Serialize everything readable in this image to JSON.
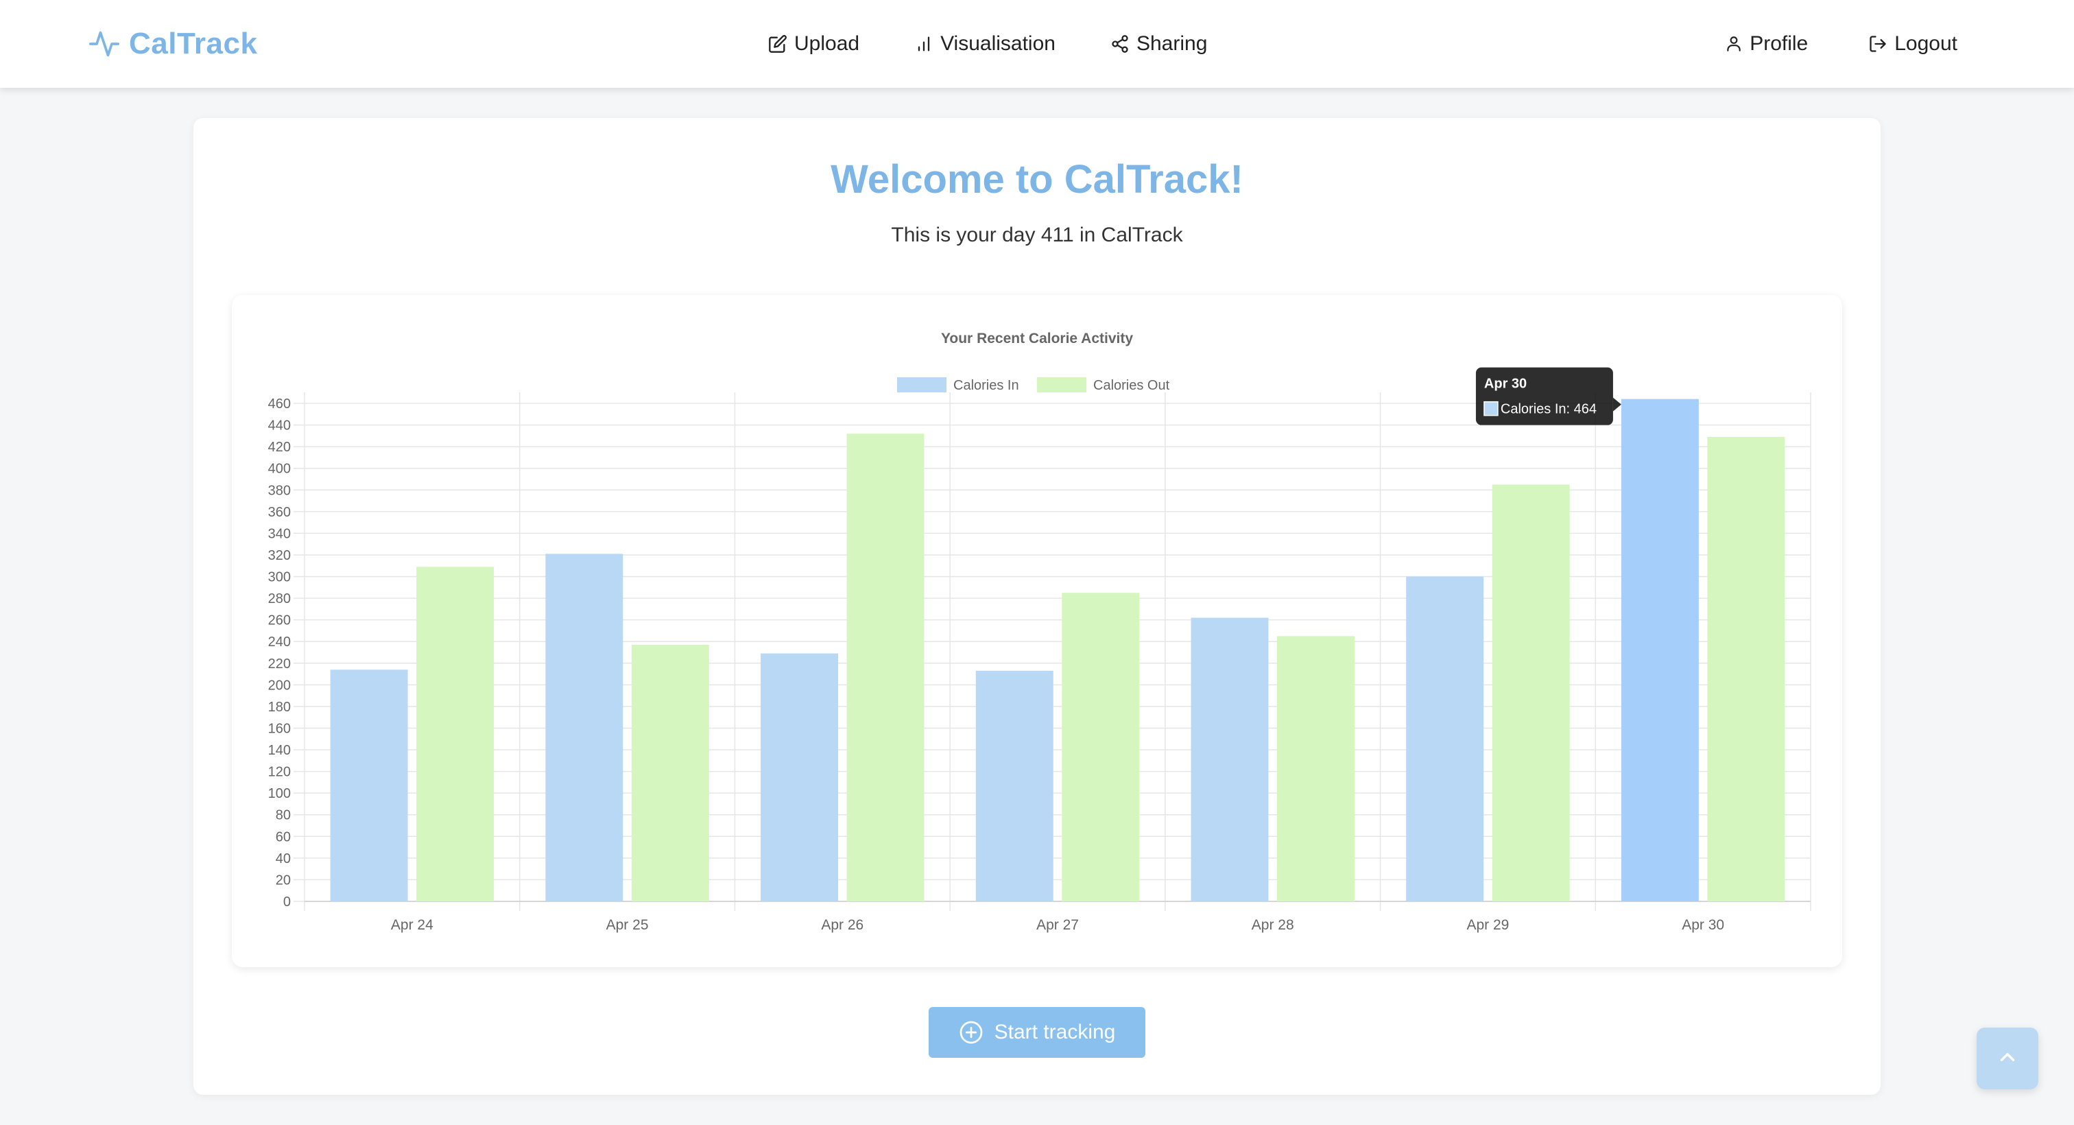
{
  "navbar": {
    "brand": "CalTrack",
    "links": {
      "upload": "Upload",
      "visualisation": "Visualisation",
      "sharing": "Sharing",
      "profile": "Profile",
      "logout": "Logout"
    }
  },
  "main": {
    "title": "Welcome to CalTrack!",
    "subtitle": "This is your day 411 in CalTrack",
    "start_button": "Start tracking"
  },
  "colors": {
    "brand": "#7cb5e6",
    "calories_in": "#b9d8f5",
    "calories_in_active": "#a5cefa",
    "calories_out": "#d5f7bf",
    "button": "#8ac0ee"
  },
  "chart_data": {
    "type": "bar",
    "title": "Your Recent Calorie Activity",
    "categories": [
      "Apr 24",
      "Apr 25",
      "Apr 26",
      "Apr 27",
      "Apr 28",
      "Apr 29",
      "Apr 30"
    ],
    "series": [
      {
        "name": "Calories In",
        "values": [
          214,
          321,
          229,
          213,
          262,
          300,
          464
        ]
      },
      {
        "name": "Calories Out",
        "values": [
          309,
          237,
          432,
          285,
          245,
          385,
          429
        ]
      }
    ],
    "ylim": [
      0,
      460
    ],
    "y_ticks": [
      0,
      20,
      40,
      60,
      80,
      100,
      120,
      140,
      160,
      180,
      200,
      220,
      240,
      260,
      280,
      300,
      320,
      340,
      360,
      380,
      400,
      420,
      440,
      460
    ],
    "legend_position": "top",
    "grid": true,
    "tooltip": {
      "title": "Apr 30",
      "label": "Calories In: 464"
    }
  },
  "icons": {
    "brand": "pulse-icon",
    "upload": "edit-icon",
    "visualisation": "bar-chart-icon",
    "sharing": "share-icon",
    "profile": "user-icon",
    "logout": "logout-icon",
    "start": "plus-circle-icon",
    "scroll_top": "chevron-up-icon"
  }
}
